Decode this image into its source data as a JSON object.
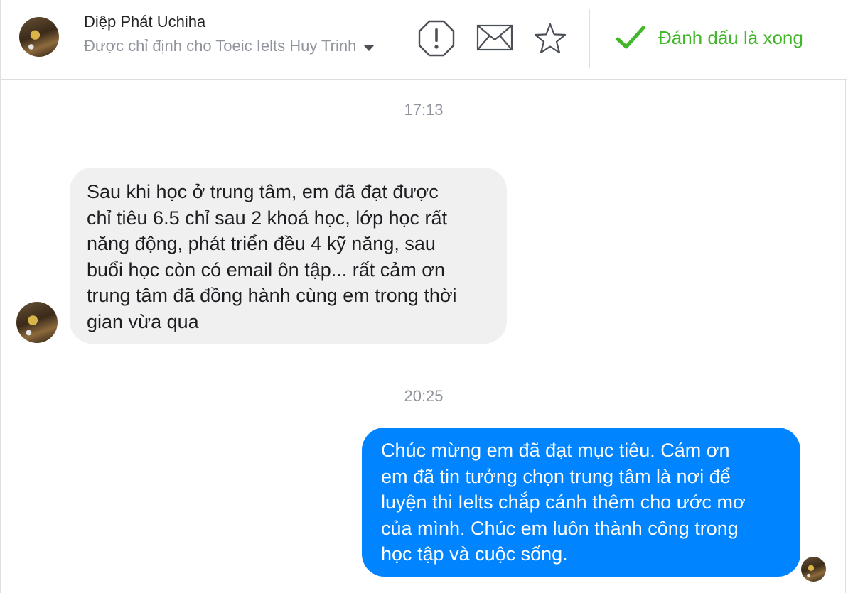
{
  "header": {
    "name": "Diệp Phát Uchiha",
    "assigned": "Được chỉ định cho Toeic Ielts Huy Trinh",
    "icons": [
      "alert-icon",
      "mail-icon",
      "star-icon",
      "check-icon",
      "chevron-down-icon"
    ],
    "done_label": "Đánh dấu là xong"
  },
  "conversation": {
    "timestamps": [
      "17:13",
      "20:25"
    ],
    "messages": [
      {
        "direction": "incoming",
        "lines": [
          "Sau khi học ở trung tâm, em đã đạt được",
          "chỉ tiêu 6.5 chỉ sau 2 khoá học, lớp học rất",
          "năng động, phát triển đều 4 kỹ năng, sau",
          "buổi học còn có email ôn tập... rất cảm ơn",
          "trung tâm đã đồng hành cùng em trong thời",
          "gian vừa qua"
        ]
      },
      {
        "direction": "outgoing",
        "lines": [
          "Chúc mừng em đã đạt mục tiêu. Cám ơn",
          "em đã tin tưởng chọn trung tâm là nơi để",
          "luyện thi Ielts chắp cánh thêm cho ước mơ",
          "của mình. Chúc em luôn thành công trong",
          "học tập và cuộc sống."
        ]
      }
    ]
  },
  "colors": {
    "outgoing_bubble": "#0084ff",
    "incoming_bubble": "#f1f0f0",
    "done_green": "#42b72a",
    "meta_gray": "#90949c"
  }
}
